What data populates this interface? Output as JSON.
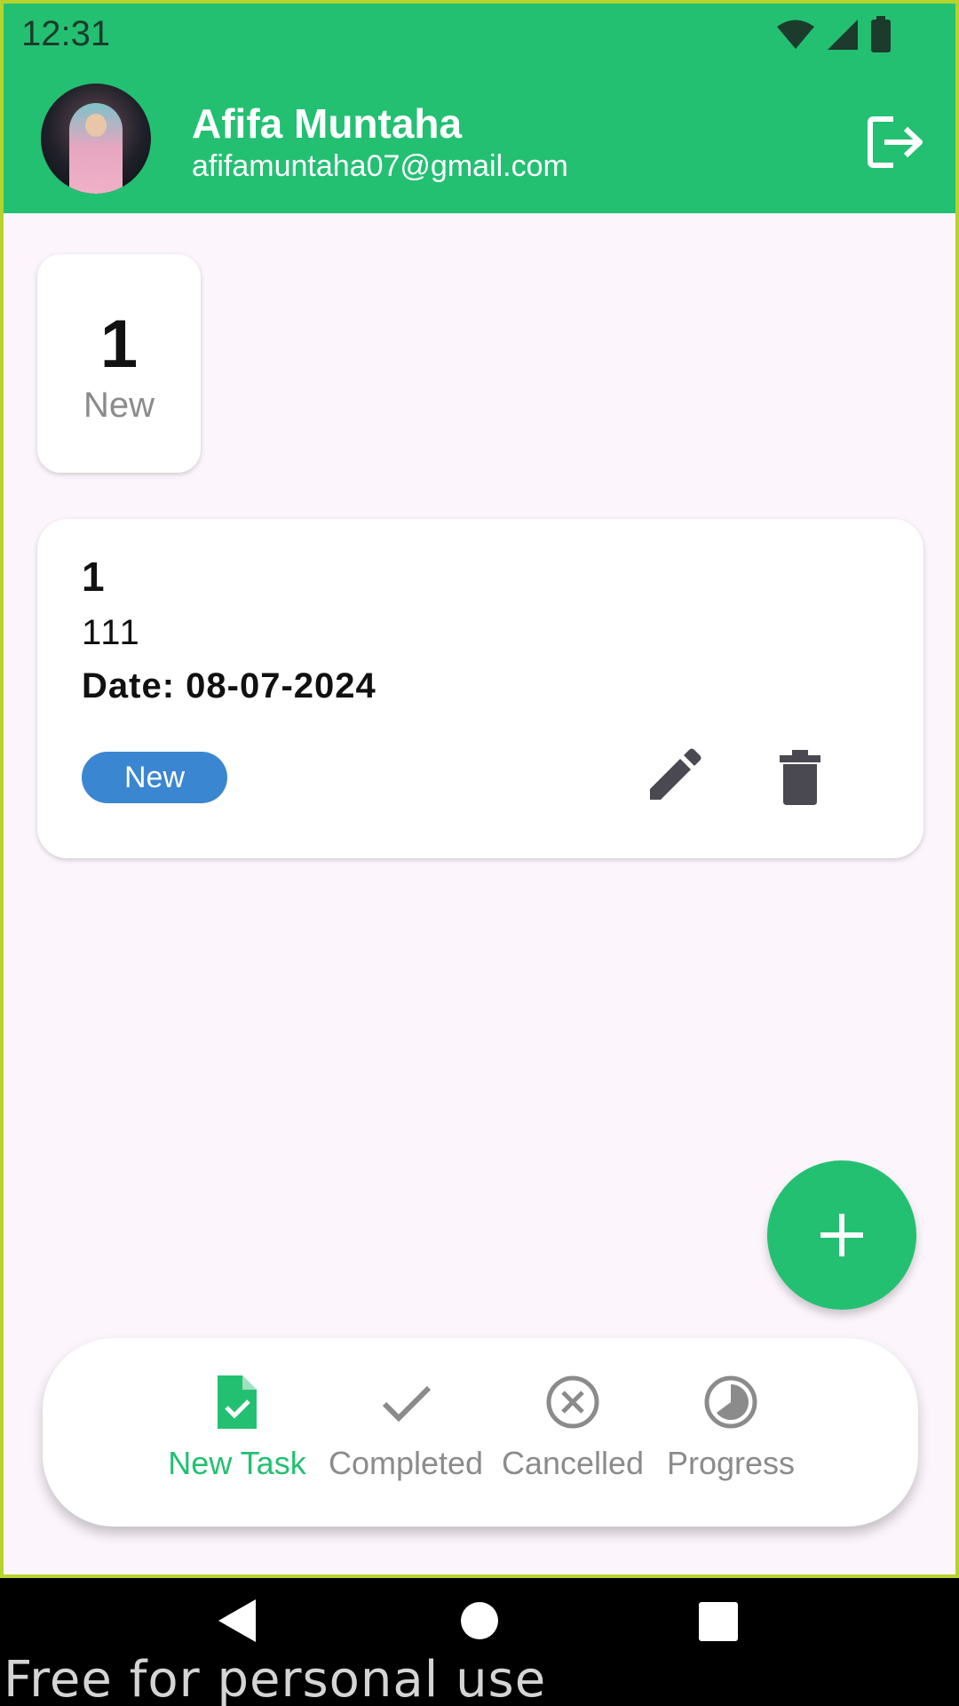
{
  "status_bar": {
    "time": "12:31"
  },
  "profile": {
    "name": "Afifa Muntaha",
    "email": "afifamuntaha07@gmail.com"
  },
  "summary": {
    "count": "1",
    "label": "New"
  },
  "task": {
    "title": "1",
    "description": "111",
    "date": "Date: 08-07-2024",
    "status": "New"
  },
  "bottom_nav": {
    "items": [
      {
        "label": "New Task",
        "icon": "task-file-check-icon",
        "active": true
      },
      {
        "label": "Completed",
        "icon": "checkmark-icon",
        "active": false
      },
      {
        "label": "Cancelled",
        "icon": "cancel-circle-icon",
        "active": false
      },
      {
        "label": "Progress",
        "icon": "progress-pie-icon",
        "active": false
      }
    ]
  },
  "watermark": "Free for personal use",
  "colors": {
    "primary": "#23c072",
    "badge": "#3b86d0",
    "background": "#fcf5fc"
  }
}
